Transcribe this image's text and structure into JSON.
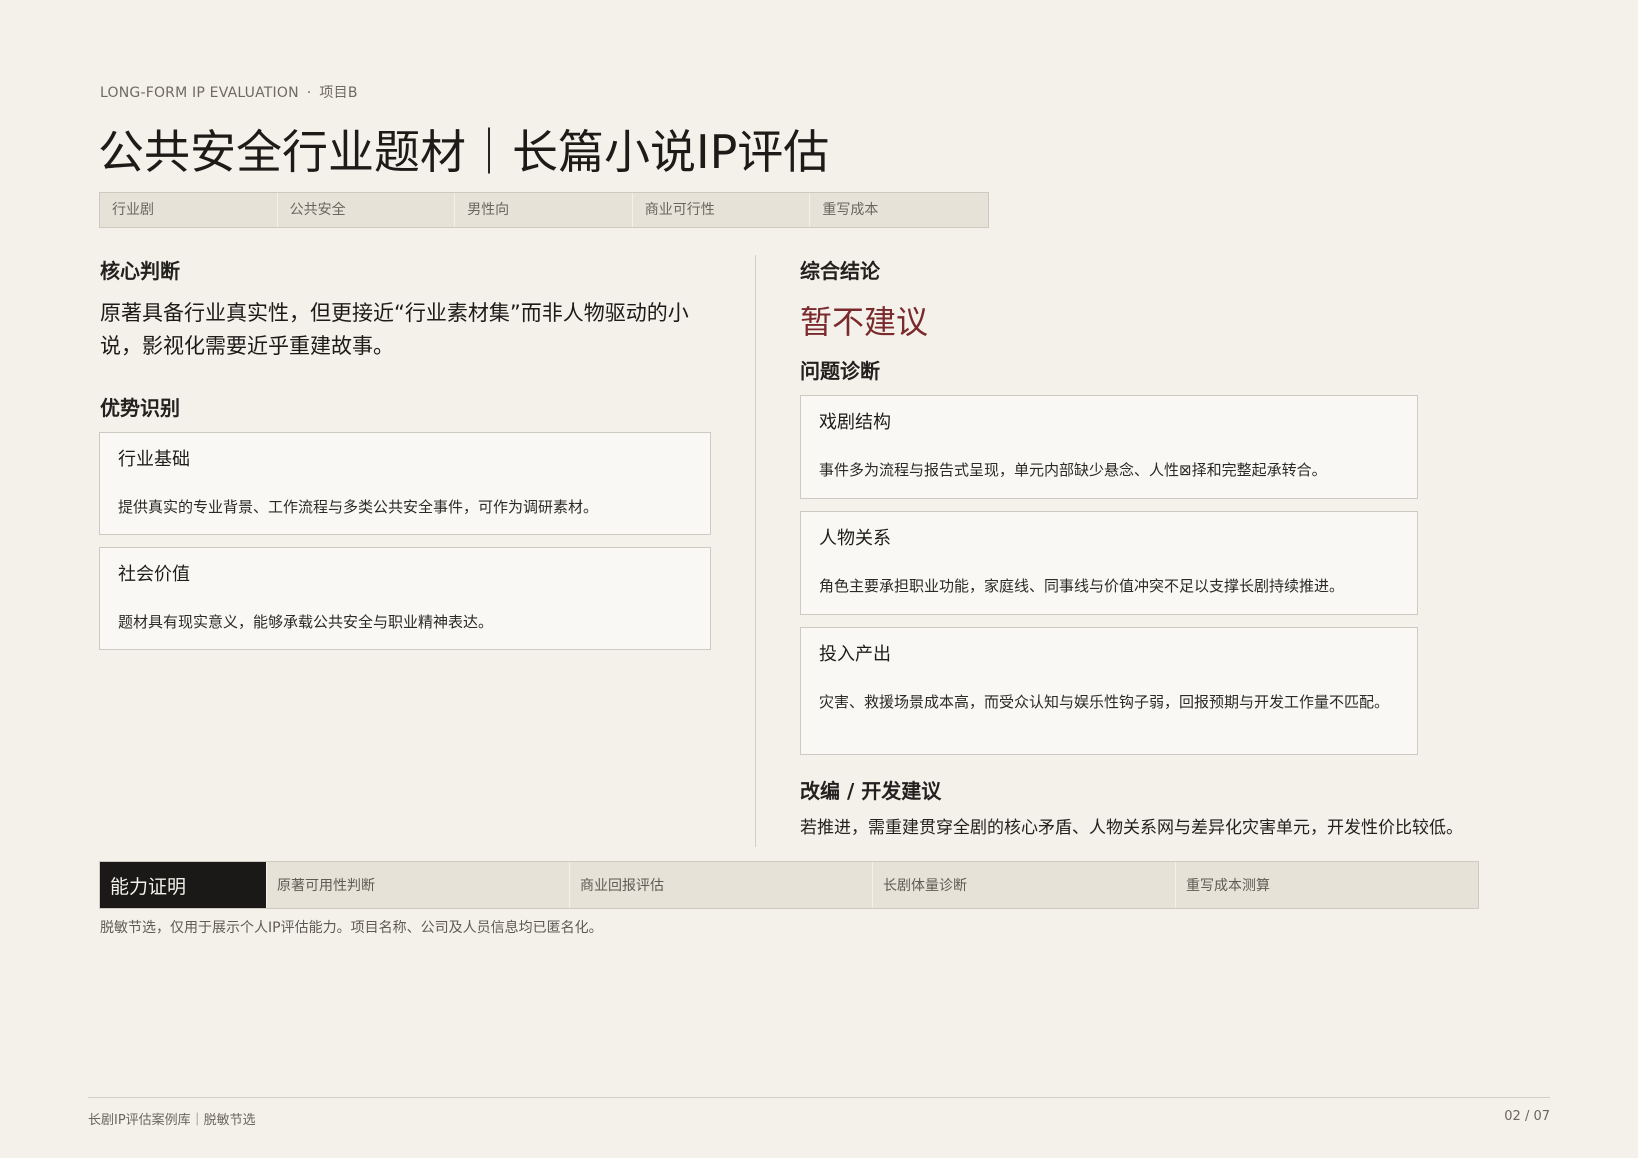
{
  "header": {
    "eyebrow_en": "LONG-FORM IP EVALUATION",
    "eyebrow_sep": "·",
    "eyebrow_project": "项目B",
    "title": "公共安全行业题材｜长篇小说IP评估"
  },
  "tags": [
    "行业剧",
    "公共安全",
    "男性向",
    "商业可行性",
    "重写成本"
  ],
  "left": {
    "core_label": "核心判断",
    "core_text": "原著具备行业真实性，但更接近“行业素材集”而非人物驱动的小说，影视化需要近乎重建故事。",
    "strengths_label": "优势识别",
    "strengths": [
      {
        "title": "行业基础",
        "body": "提供真实的专业背景、工作流程与多类公共安全事件，可作为调研素材。"
      },
      {
        "title": "社会价值",
        "body": "题材具有现实意义，能够承载公共安全与职业精神表达。"
      }
    ]
  },
  "right": {
    "conclusion_label": "综合结论",
    "verdict": "暂不建议",
    "verdict_color": "#7a2a2c",
    "diagnosis_label": "问题诊断",
    "issues": [
      {
        "title": "戏剧结构",
        "body": "事件多为流程与报告式呈现，单元内部缺少悬念、人性⊠择和完整起承转合。"
      },
      {
        "title": "人物关系",
        "body": "角色主要承担职业功能，家庭线、同事线与价值冲突不足以支撑长剧持续推进。"
      },
      {
        "title": "投入产出",
        "body": "灾害、救援场景成本高，而受众认知与娱乐性钩子弱，回报预期与开发工作量不匹配。"
      }
    ],
    "advice_label": "改编 / 开发建议",
    "advice_text": "若推进，需重建贯穿全剧的核心矛盾、人物关系网与差异化灾害单元，开发性价比较低。"
  },
  "proof": {
    "head": "能力证明",
    "items": [
      "原著可用性判断",
      "商业回报评估",
      "长剧体量诊断",
      "重写成本测算"
    ]
  },
  "disclaimer": "脱敏节选，仅用于展示个人IP评估能力。项目名称、公司及人员信息均已匿名化。",
  "footer": {
    "left": "长剧IP评估案例库｜脱敏节选",
    "right": "02 / 07"
  }
}
